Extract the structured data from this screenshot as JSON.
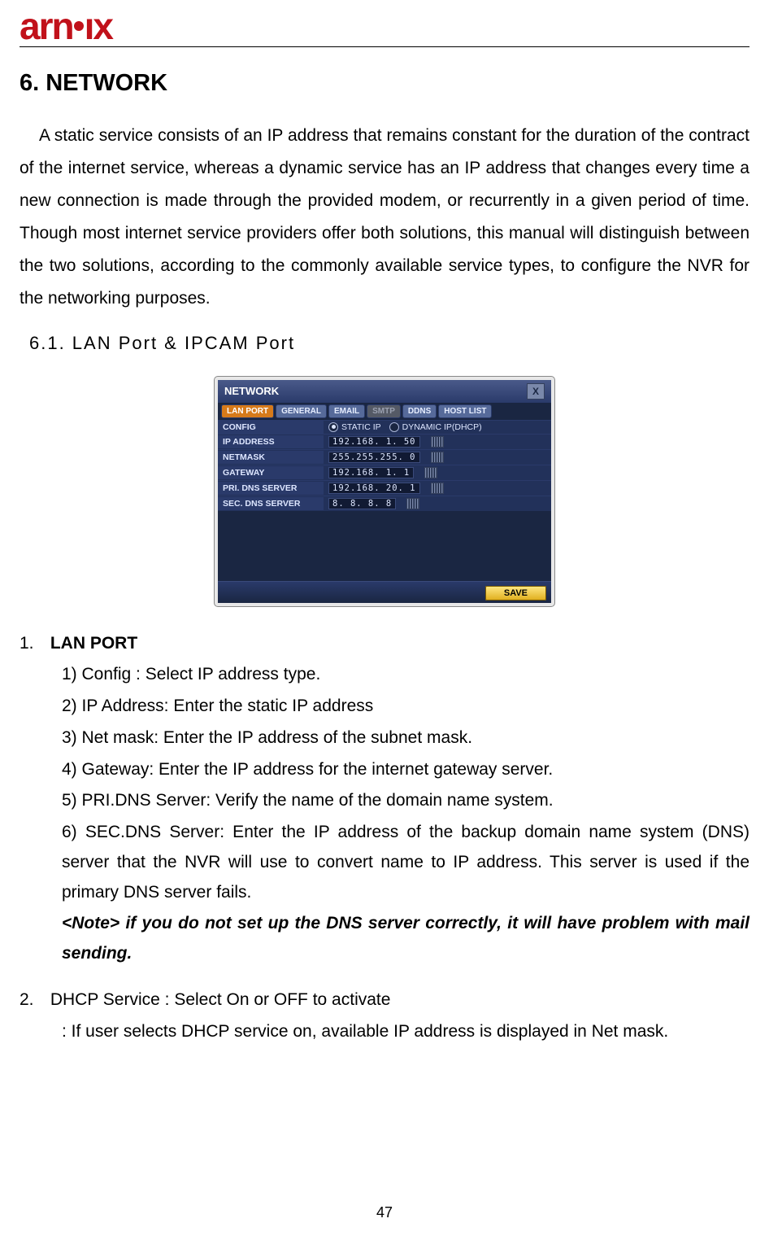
{
  "brand": "arnix",
  "section_title": "6. NETWORK",
  "intro_paragraph": "A static service consists of an IP address that remains constant for the duration of the contract of the internet service, whereas a dynamic service has an IP address that changes every time a new connection is made through the provided modem, or recurrently in a given period of time. Though most internet service providers offer both solutions, this manual will distinguish between the two solutions, according to the commonly available service types, to configure the NVR for the networking purposes.",
  "subsection_title": "6.1.  LAN  Port  &  IPCAM  Port",
  "screenshot": {
    "window_title": "NETWORK",
    "close_glyph": "X",
    "tabs": [
      {
        "label": "LAN PORT",
        "state": "active"
      },
      {
        "label": "GENERAL",
        "state": "normal"
      },
      {
        "label": "EMAIL",
        "state": "normal"
      },
      {
        "label": "SMTP",
        "state": "disabled"
      },
      {
        "label": "DDNS",
        "state": "normal"
      },
      {
        "label": "HOST LIST",
        "state": "normal"
      }
    ],
    "config": {
      "label": "CONFIG",
      "options": [
        {
          "label": "STATIC IP",
          "selected": true
        },
        {
          "label": "DYNAMIC IP(DHCP)",
          "selected": false
        }
      ]
    },
    "fields": [
      {
        "label": "IP ADDRESS",
        "value": "192.168.  1. 50"
      },
      {
        "label": "NETMASK",
        "value": "255.255.255.  0"
      },
      {
        "label": "GATEWAY",
        "value": "192.168.  1.  1"
      },
      {
        "label": "PRI. DNS SERVER",
        "value": "192.168. 20.  1"
      },
      {
        "label": "SEC. DNS SERVER",
        "value": "  8.  8.  8.  8"
      }
    ],
    "save_label": "SAVE"
  },
  "list1": {
    "num": "1.",
    "heading": "LAN PORT",
    "items": [
      "1) Config : Select IP address type.",
      "2) IP Address: Enter the static IP address",
      "3) Net mask: Enter the IP address of the subnet mask.",
      "4) Gateway: Enter the IP address for the internet gateway server.",
      "5) PRI.DNS Server: Verify the name of the domain name system.",
      "6) SEC.DNS Server: Enter the IP address of the backup domain name system (DNS) server that the NVR will use to convert name to IP address. This server is used if the primary DNS server fails."
    ],
    "note": "<Note> if you do not set up the DNS server correctly, it will have problem with mail sending."
  },
  "list2": {
    "num": "2.",
    "heading": "DHCP Service : Select On or OFF to activate",
    "detail": ": If user selects DHCP service on, available IP address is displayed in Net mask."
  },
  "page_number": "47"
}
